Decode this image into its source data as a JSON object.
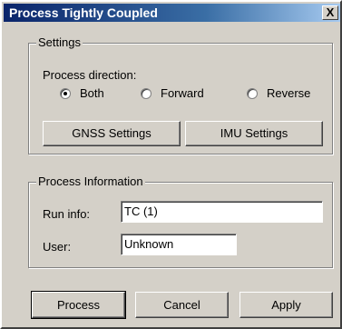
{
  "window": {
    "title": "Process Tightly Coupled",
    "close_label": "X"
  },
  "settings": {
    "group_label": "Settings",
    "direction_label": "Process direction:",
    "options": [
      {
        "label": "Both",
        "selected": true
      },
      {
        "label": "Forward",
        "selected": false
      },
      {
        "label": "Reverse",
        "selected": false
      }
    ],
    "gnss_button": "GNSS Settings",
    "imu_button": "IMU Settings"
  },
  "info": {
    "group_label": "Process Information",
    "run_info_label": "Run info:",
    "run_info_value": "TC (1)",
    "user_label": "User:",
    "user_value": "Unknown"
  },
  "buttons": {
    "process": "Process",
    "cancel": "Cancel",
    "apply": "Apply"
  }
}
